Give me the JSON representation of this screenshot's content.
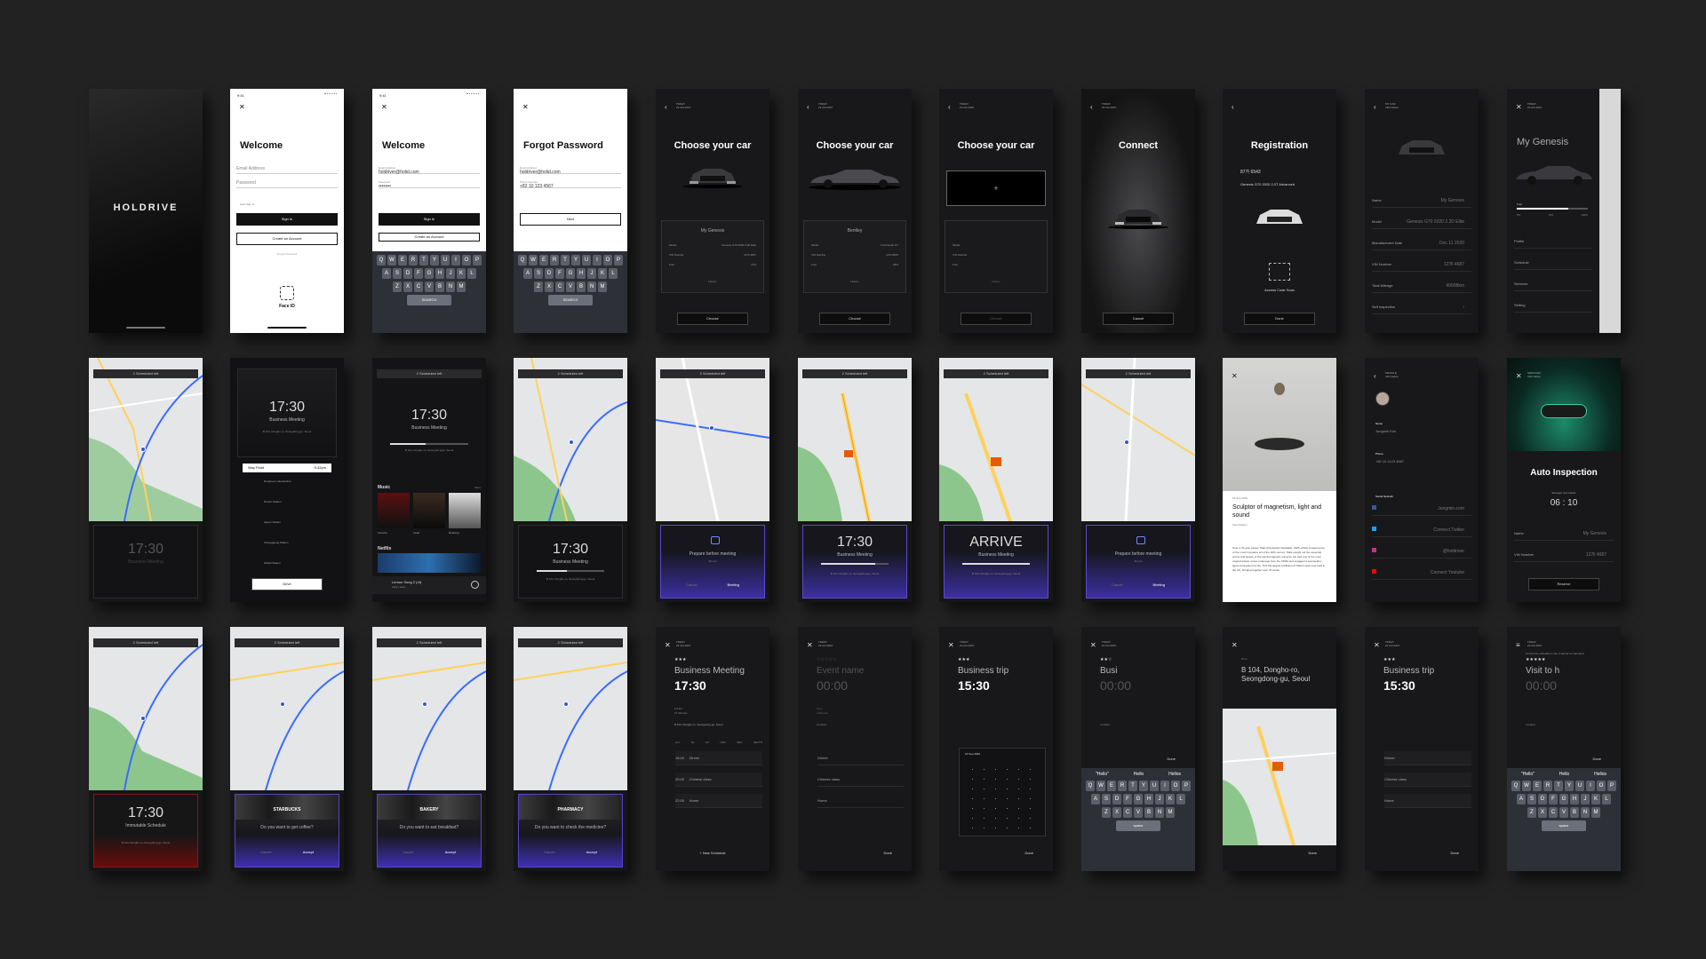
{
  "common": {
    "status_time": "9:41",
    "close": "✕",
    "back": "‹",
    "today": "TODAY",
    "date": "21.Oct.2027",
    "menu": "≡",
    "scheduled": "2 Scheduled left"
  },
  "c1": {
    "brand": "HOLDRIVE"
  },
  "c2": {
    "title": "Welcome",
    "email": "Email Address",
    "password": "Password",
    "auto": "Auto Sign In",
    "signin": "Sign In",
    "create": "Create an Account",
    "forgot": "Forgot Password",
    "faceid": "Face ID"
  },
  "c3": {
    "title": "Welcome",
    "email_label": "Email Address",
    "email": "holdriver@holid.com",
    "pw_label": "Password",
    "pw": "••••••••",
    "signin": "Sign In",
    "create": "Create an Account"
  },
  "c4": {
    "title": "Forgot Password",
    "email_label": "Email Address",
    "email": "holdriver@holid.com",
    "phone_label": "Phone Number",
    "phone": "+82 10 123 4567",
    "next": "Next"
  },
  "keyboard": {
    "row1": [
      "Q",
      "W",
      "E",
      "R",
      "T",
      "Y",
      "U",
      "I",
      "O",
      "P"
    ],
    "row2": [
      "A",
      "S",
      "D",
      "F",
      "G",
      "H",
      "J",
      "K",
      "L"
    ],
    "row3": [
      "Z",
      "X",
      "C",
      "V",
      "B",
      "N",
      "M"
    ],
    "search": "SEARCH",
    "space": "space",
    "suggest": [
      "\"Hello\"",
      "Hello",
      "Hellos"
    ]
  },
  "c5": {
    "title": "Choose your car",
    "card": "My Genesis",
    "model_l": "Model",
    "model": "Genesis G70 2020 2.2D Elite",
    "vin_l": "VIN Number",
    "vin": "127ll 4687",
    "fuel_l": "Fuel",
    "fuel": "72%",
    "history": "History",
    "btn": "Choose"
  },
  "c6": {
    "title": "Choose your car",
    "card": "Bentley",
    "model": "Continental GT",
    "vin": "127ll 9876",
    "fuel": "28%",
    "history": "History",
    "btn": "Choose"
  },
  "c7": {
    "title": "Choose your car",
    "plus": "+",
    "history": "History",
    "btn": "Choose"
  },
  "c8": {
    "title": "Connect",
    "btn": "Cancel"
  },
  "c9": {
    "title": "Registration",
    "plate": "87가 6543",
    "model": "Genesis G70 2020 2.0T Advanced",
    "scan": "Access Code Scan",
    "btn": "Done"
  },
  "c10": {
    "head": "MY CAR",
    "sub": "Information",
    "rows": [
      [
        "Name",
        "My Genesis"
      ],
      [
        "Model",
        "Genesis G70 2020 2.2D Elite"
      ],
      [
        "Manufactured Date",
        "Dec 11 2020"
      ],
      [
        "VIN Number",
        "127ll 4687"
      ],
      [
        "Total Mileage",
        "40008km"
      ],
      [
        "Self Inspection",
        "›"
      ]
    ]
  },
  "c11": {
    "title": "My Genesis",
    "fuel": "Fuel",
    "pcts": [
      "0%",
      "72%",
      "100%"
    ],
    "menu": [
      "Profile",
      "Schedule",
      "Services",
      "Setting"
    ]
  },
  "r2c2": {
    "time": "17:30",
    "name": "Business Meeting",
    "addr": "B 104, Dongho-ro, Seongdong-gu, Seoul",
    "way": "Way Point",
    "way_t": "5:32pm",
    "stops": [
      "Dongho-ro Intersection",
      "Dowon Station",
      "Jiyeon Station",
      "Chunggaeng Station",
      "Okheli Station"
    ],
    "btn": "Drive"
  },
  "r2c3": {
    "time": "17:30",
    "name": "Business Meeting",
    "addr": "B 104, Dongho-ro, Seongdong-gu, Seoul",
    "music": "Music",
    "more": "More",
    "m": [
      "Favorite",
      "Liked",
      "Relaxing"
    ],
    "netflix": "Netflix",
    "track": "Lemon Song 2 (of)",
    "artist": "Felly Lukas"
  },
  "r2c1": {
    "time": "17:30",
    "name": "Business Meeting"
  },
  "r2c4": {
    "time": "17:30",
    "name": "Business Meeting",
    "addr": "B 104, Dongho-ro, Seongdong-gu, Seoul"
  },
  "r2c5": {
    "msg": "Prepare before meeting",
    "sub": "30 min",
    "cancel": "Cancel",
    "brief": "Briefing"
  },
  "r2c6": {
    "time": "17:30",
    "name": "Business Meeting",
    "addr": "B 104, Dongho-ro, Seongdong-gu, Seoul"
  },
  "r2c7": {
    "time": "ARRIVE",
    "name": "Business Meeting",
    "addr": "B 104, Dongho-ro, Seongdong-gu, Seoul"
  },
  "r2c8": {
    "msg": "Prepare before meeting",
    "sub": "30 min",
    "cancel": "Cancel",
    "brief": "Briefing"
  },
  "r2c9": {
    "date": "15 Sep 2019",
    "title": "Sculptor of magnetism, light and sound",
    "by": "Tate Modern",
    "body": "Over a 70-year career, Takis (Panayiotis Vassilakis, 1925–2019) created some of the most innovative art of the 20th century. Takis sought out the essential poetry and beauty of the electromagnetic universe. He was one of the most original artistic voices in Europe from the 1950s and engaged a succeeding figure throughout his life. This the largest exhibition of Takis's work ever held in the UK, bringing together over 70 works."
  },
  "r2c10": {
    "head": "PROFILE",
    "sub": "Information",
    "name_l": "Name",
    "name": "Jungmin Kim",
    "phone_l": "Phone",
    "phone": "+82 10 1123 4567",
    "social": "Social Network",
    "links": [
      "Jungmin.com",
      "Connect Twitter",
      "@holdriver",
      "Connect Youtube"
    ]
  },
  "r2c11": {
    "head": "SERVICES",
    "sub": "Information",
    "title": "Auto Inspection",
    "center": "Seongsu Car Center",
    "time": "06 : 10",
    "rows": [
      [
        "Name",
        "My Genesis"
      ],
      [
        "VIN Number",
        "127ll 4687"
      ]
    ],
    "btn": "Reserve"
  },
  "r3c1": {
    "time": "17:30",
    "name": "Immutable Schedule",
    "addr": "B 104, Dongho-ro, Seongdong-gu, Seoul"
  },
  "r3c2": {
    "head": "STARBUCKS",
    "q": "Do you want to get coffee?",
    "cancel": "Cancel",
    "accept": "Accept"
  },
  "r3c3": {
    "head": "BAKERY",
    "q": "Do you want to eat breakfast?",
    "cancel": "Cancel",
    "accept": "Accept"
  },
  "r3c4": {
    "head": "PHARMACY",
    "q": "Do you want to check the medicine?",
    "cancel": "Cancel",
    "accept": "Accept"
  },
  "r3c5": {
    "stars": "★★★",
    "name": "Business Meeting",
    "time": "17:30",
    "dist": "9.6 km",
    "dur": "37 Minutes",
    "loc": "B 104, Dongho-ro, Seongdong-gu, Seoul",
    "tabs": [
      "ALL",
      "D1",
      "D2",
      "HAN",
      "NEX",
      "NEXTN"
    ],
    "rows": [
      "Dinner",
      "Chinese class",
      "Home"
    ],
    "times": [
      "18:00",
      "20:00",
      "22:00"
    ],
    "new": "+ New Schedule"
  },
  "r3c6": {
    "stars": "☆☆☆☆☆",
    "name": "Event name",
    "time": "00:00",
    "dist": "0 km",
    "dur": "0 Minutes",
    "loc": "Location",
    "rows": [
      "Dinner",
      "Chinese class",
      "Home"
    ],
    "done": "Done"
  },
  "r3c7": {
    "stars": "★★★",
    "name": "Business trip",
    "time": "15:30",
    "cal": "16 Sep 2026",
    "done": "Done"
  },
  "r3c8": {
    "stars": "★★☆",
    "name": "Busi",
    "time": "00:00",
    "loc": "Location",
    "done": "Done"
  },
  "r3c9": {
    "dist": "8 km",
    "addr": "B 104, Dongho-ro, Seongdong-gu, Seoul",
    "done": "Done"
  },
  "r3c10": {
    "stars": "★★★",
    "name": "Business trip",
    "time": "15:30",
    "rows": [
      "Dinner",
      "Chinese class",
      "Home"
    ],
    "done": "Done"
  },
  "r3c11": {
    "note": "If Once the schedule is set, it cannot be canceled.",
    "stars": "★★★★★",
    "name": "Visit to h",
    "time": "00:00",
    "loc": "Location",
    "done": "Done"
  }
}
